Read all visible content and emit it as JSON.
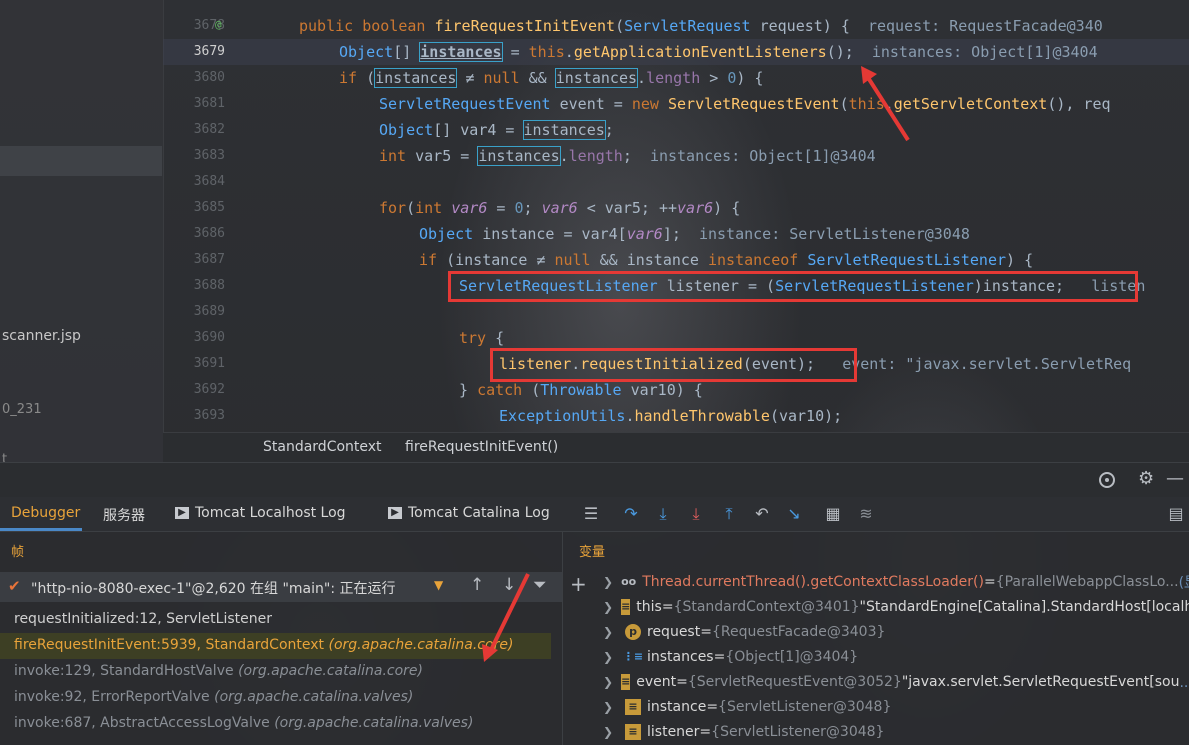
{
  "left_panel": {
    "items": [
      "scanner.jsp",
      "0_231",
      "t"
    ]
  },
  "editor": {
    "line_numbers": [
      "3678",
      "3679",
      "3680",
      "3681",
      "3682",
      "3683",
      "3684",
      "3685",
      "3686",
      "3687",
      "3688",
      "3689",
      "3690",
      "3691",
      "3692",
      "3693"
    ],
    "current_line": "3679",
    "gutter_marker": "@",
    "hints": {
      "l0": "request: RequestFacade@340",
      "l1": "instances: Object[1]@3404",
      "l5": "instances: Object[1]@3404",
      "l8": "instance: ServletListener@3048",
      "l10": "listen",
      "l13": "event: \"javax.servlet.ServletReq"
    }
  },
  "breadcrumb": {
    "class": "StandardContext",
    "method": "fireRequestInitEvent()"
  },
  "tool_tabs": {
    "debugger": "Debugger",
    "server": "服务器",
    "localhost_log": "Tomcat Localhost Log",
    "catalina_log": "Tomcat Catalina Log"
  },
  "frames_panel": {
    "title": "帧",
    "thread": "\"http-nio-8080-exec-1\"@2,620 在组 \"main\": 正在运行",
    "frames": [
      {
        "method": "requestInitialized:12, ServletListener",
        "pkg": ""
      },
      {
        "method": "fireRequestInitEvent:5939, StandardContext",
        "pkg": "(org.apache.catalina.core)"
      },
      {
        "method": "invoke:129, StandardHostValve",
        "pkg": "(org.apache.catalina.core)"
      },
      {
        "method": "invoke:92, ErrorReportValve",
        "pkg": "(org.apache.catalina.valves)"
      },
      {
        "method": "invoke:687, AbstractAccessLogValve",
        "pkg": "(org.apache.catalina.valves)"
      }
    ]
  },
  "vars_panel": {
    "title": "变量",
    "vars": [
      {
        "icon": "oo",
        "name": "Thread.currentThread().getContextClassLoader()",
        "eq": " = ",
        "type": "{ParallelWebappClassLo...",
        "value": "",
        "link": "(显示"
      },
      {
        "icon": "field",
        "name": "this",
        "eq": " = ",
        "type": "{StandardContext@3401}",
        "value": " \"StandardEngine[Catalina].StandardHost[localho",
        "link": ""
      },
      {
        "icon": "p",
        "name": "request",
        "eq": " = ",
        "type": "{RequestFacade@3403}",
        "value": "",
        "link": ""
      },
      {
        "icon": "array",
        "name": "instances",
        "eq": " = ",
        "type": "{Object[1]@3404}",
        "value": "",
        "link": ""
      },
      {
        "icon": "field",
        "name": "event",
        "eq": " = ",
        "type": "{ServletRequestEvent@3052}",
        "value": " \"javax.servlet.ServletRequestEvent[sou",
        "link": "...(显示"
      },
      {
        "icon": "field",
        "name": "instance",
        "eq": " = ",
        "type": "{ServletListener@3048}",
        "value": "",
        "link": ""
      },
      {
        "icon": "field",
        "name": "listener",
        "eq": " = ",
        "type": "{ServletListener@3048}",
        "value": "",
        "link": ""
      }
    ]
  },
  "colors": {
    "keyword": "#cc7832",
    "type": "#56a8f5",
    "method": "#ffc66d",
    "text": "#a9b7c6",
    "italic_var": "#b389c5",
    "highlight_box": "#e53935",
    "active_tab": "#e8a33a"
  }
}
